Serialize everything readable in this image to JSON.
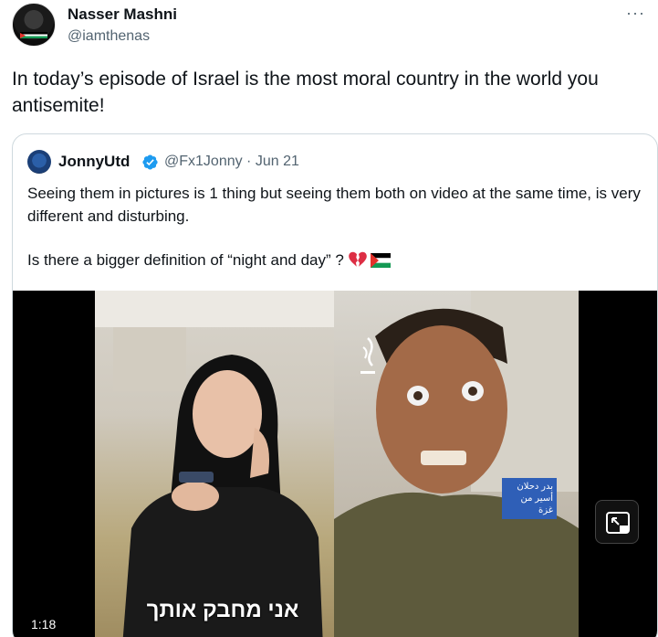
{
  "author": {
    "name": "Nasser Mashni",
    "handle": "@iamthenas",
    "avatar_icon": "profile-avatar"
  },
  "tweet": {
    "text": "In today’s episode of Israel is the most moral country in the world you antisemite!",
    "more_label": "···"
  },
  "quoted": {
    "name": "JonnyUtd",
    "handle_meta": "@Fx1Jonny · Jun 21",
    "verified_color": "#1d9bf0",
    "paragraph1": "Seeing them in pictures is 1 thing but seeing them both on video at the same time, is very different and disturbing.",
    "paragraph2": "Is there a bigger definition of “night and day” ?",
    "emojis": [
      "broken-heart",
      "palestine-flag"
    ]
  },
  "video": {
    "duration": "1:18",
    "caption": "אני מחבק אותך",
    "label_line1": "بدر دحلان",
    "label_line2": "أسير من غزة",
    "pip_icon": "picture-in-picture-icon"
  }
}
